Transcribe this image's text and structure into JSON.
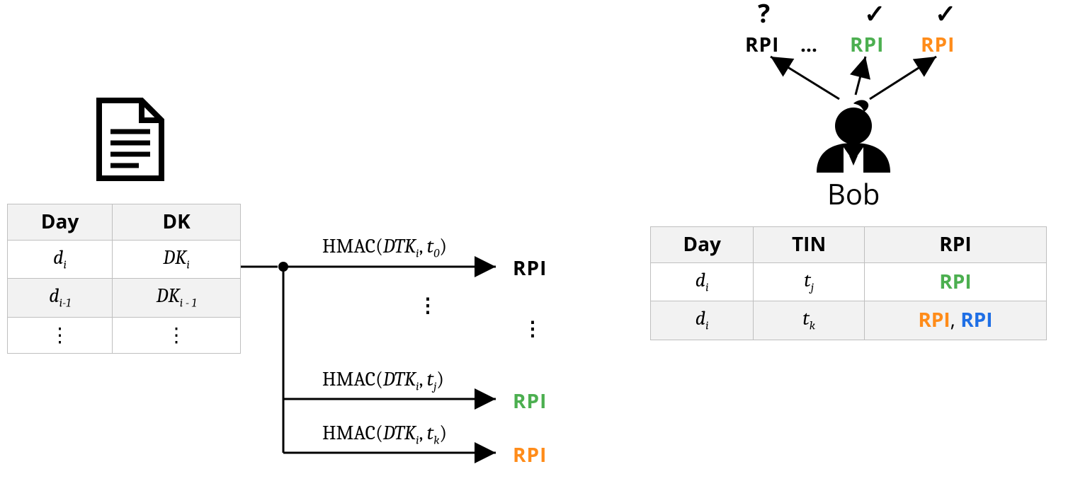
{
  "leftTable": {
    "headers": {
      "day": "Day",
      "dk": "DK"
    },
    "rows": [
      {
        "day": "d",
        "day_sub": "i",
        "dk": "DK",
        "dk_sub": "i"
      },
      {
        "day": "d",
        "day_sub": "i-1",
        "dk": "DK",
        "dk_sub": "i - 1"
      },
      {
        "day": "⋮",
        "day_sub": "",
        "dk": "⋮",
        "dk_sub": ""
      }
    ]
  },
  "hmac": {
    "prefix": "HMAC(",
    "key": "DTK",
    "key_sub": "i",
    "sep": ", ",
    "t": "t",
    "t0_sub": "0",
    "tj_sub": "j",
    "tk_sub": "k",
    "suffix": ")"
  },
  "center_rpi": {
    "rpi_black": "RPI",
    "rpi_green": "RPI",
    "rpi_orange": "RPI",
    "vdots1": "⋮",
    "vdots2": "⋮",
    "hdots": "…"
  },
  "bob": {
    "name": "Bob",
    "marks": {
      "q": "?",
      "c1": "✓",
      "c2": "✓"
    },
    "top_rpis": {
      "b": "RPI",
      "g": "RPI",
      "o": "RPI"
    }
  },
  "rightTable": {
    "headers": {
      "day": "Day",
      "tin": "TIN",
      "rpi": "RPI"
    },
    "rows": [
      {
        "day": "d",
        "day_sub": "i",
        "tin": "t",
        "tin_sub": "j",
        "rpi_parts": [
          {
            "text": "RPI",
            "cls": "green"
          }
        ]
      },
      {
        "day": "d",
        "day_sub": "i",
        "tin": "t",
        "tin_sub": "k",
        "rpi_parts": [
          {
            "text": "RPI",
            "cls": "orange"
          },
          {
            "text": ", ",
            "cls": ""
          },
          {
            "text": "RPI",
            "cls": "blue"
          }
        ]
      }
    ]
  },
  "icons": {
    "doc": "document-icon",
    "person": "person-icon"
  }
}
